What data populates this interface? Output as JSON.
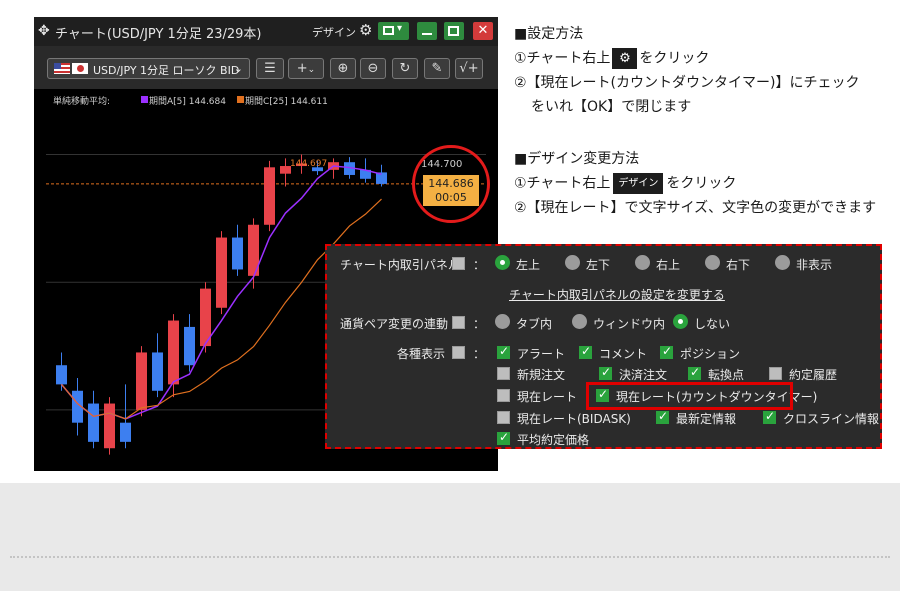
{
  "window": {
    "title": "チャート(USD/JPY 1分足 23/29本)",
    "design_label": "デザイン",
    "symbol_select": "USD/JPY 1分足 ローソク BID",
    "toolbar_buttons": [
      "layers-icon",
      "crosshair-plus-icon",
      "zoom-in-icon",
      "zoom-out-icon",
      "refresh-icon",
      "pencil-icon",
      "indicator-icon"
    ]
  },
  "indicators": {
    "label": "単純移動平均:",
    "ma_a": "期間A[5] 144.684",
    "ma_c": "期間C[25] 144.611",
    "ma_a_color": "#9b30ff",
    "ma_c_color": "#e0701f"
  },
  "chart": {
    "high_label": "144.700",
    "annotation": "144.697",
    "current_price": "144.686",
    "countdown": "00:05"
  },
  "chart_data": {
    "type": "candlestick",
    "candles": [
      {
        "o": 144.535,
        "h": 144.545,
        "l": 144.515,
        "c": 144.52
      },
      {
        "o": 144.515,
        "h": 144.525,
        "l": 144.48,
        "c": 144.49
      },
      {
        "o": 144.505,
        "h": 144.515,
        "l": 144.47,
        "c": 144.475
      },
      {
        "o": 144.47,
        "h": 144.51,
        "l": 144.465,
        "c": 144.505
      },
      {
        "o": 144.49,
        "h": 144.52,
        "l": 144.47,
        "c": 144.475
      },
      {
        "o": 144.5,
        "h": 144.55,
        "l": 144.495,
        "c": 144.545
      },
      {
        "o": 144.545,
        "h": 144.56,
        "l": 144.51,
        "c": 144.515
      },
      {
        "o": 144.52,
        "h": 144.575,
        "l": 144.51,
        "c": 144.57
      },
      {
        "o": 144.565,
        "h": 144.575,
        "l": 144.53,
        "c": 144.535
      },
      {
        "o": 144.55,
        "h": 144.6,
        "l": 144.545,
        "c": 144.595
      },
      {
        "o": 144.58,
        "h": 144.64,
        "l": 144.575,
        "c": 144.635
      },
      {
        "o": 144.635,
        "h": 144.645,
        "l": 144.605,
        "c": 144.61
      },
      {
        "o": 144.605,
        "h": 144.65,
        "l": 144.595,
        "c": 144.645
      },
      {
        "o": 144.645,
        "h": 144.695,
        "l": 144.64,
        "c": 144.69
      },
      {
        "o": 144.685,
        "h": 144.697,
        "l": 144.675,
        "c": 144.691
      },
      {
        "o": 144.691,
        "h": 144.7,
        "l": 144.685,
        "c": 144.693
      },
      {
        "o": 144.69,
        "h": 144.695,
        "l": 144.684,
        "c": 144.687
      },
      {
        "o": 144.688,
        "h": 144.697,
        "l": 144.681,
        "c": 144.694
      },
      {
        "o": 144.694,
        "h": 144.698,
        "l": 144.681,
        "c": 144.684
      },
      {
        "o": 144.688,
        "h": 144.697,
        "l": 144.678,
        "c": 144.681
      },
      {
        "o": 144.686,
        "h": 144.692,
        "l": 144.675,
        "c": 144.677
      }
    ],
    "ylim": [
      144.46,
      144.72
    ],
    "ma_a_color": "#9b30ff",
    "ma_c_color": "#e0701f",
    "up_color": "#e8434a",
    "down_color": "#3d7ff0"
  },
  "instructions": {
    "settings_heading": "■設定方法",
    "step1_a": "①チャート右上",
    "step1_b": "をクリック",
    "step2": "②【現在レート(カウントダウンタイマー)】にチェック",
    "step2_cont": "をいれ【OK】で閉じます",
    "design_heading": "■デザイン変更方法",
    "design1_a": "①チャート右上",
    "design_chip": "デザイン",
    "design1_b": "をクリック",
    "design2": "②【現在レート】で文字サイズ、文字色の変更ができます"
  },
  "panel": {
    "row1_label": "チャート内取引パネル",
    "colon": "：",
    "row1_options": [
      "左上",
      "左下",
      "右上",
      "右下",
      "非表示"
    ],
    "link": "チャート内取引パネルの設定を変更する",
    "row2_label": "通貨ペア変更の連動",
    "row2_options": [
      "タブ内",
      "ウィンドウ内",
      "しない"
    ],
    "row3_label": "各種表示",
    "checks": [
      "アラート",
      "コメント",
      "ポジション",
      "新規注文",
      "決済注文",
      "転換点",
      "約定履歴",
      "現在レート",
      "現在レート(カウントダウンタイマー)",
      "現在レート(BIDASK)",
      "最新定情報",
      "クロスライン情報",
      "平均約定価格"
    ]
  }
}
